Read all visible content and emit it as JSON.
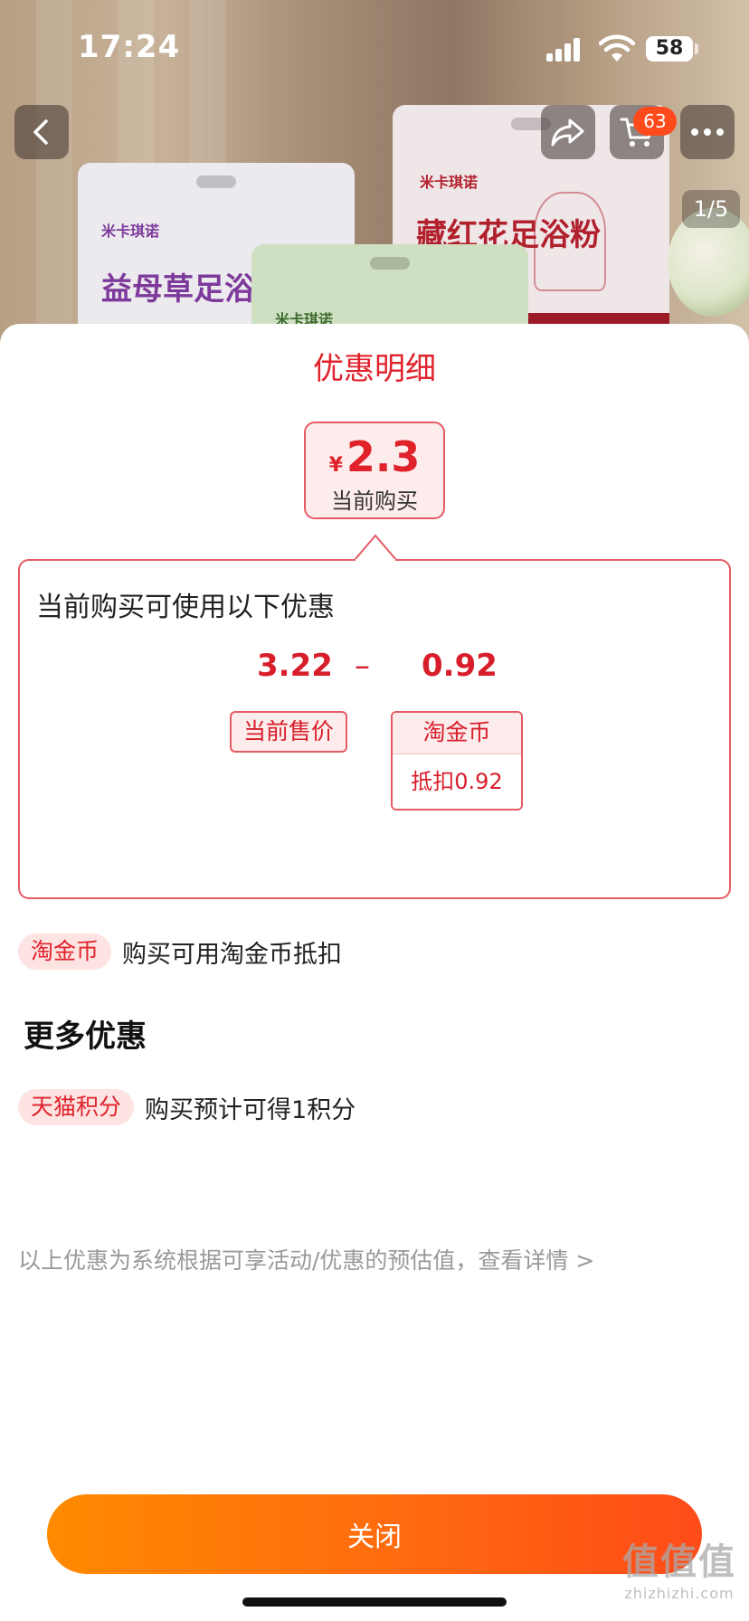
{
  "status_bar": {
    "time": "17:24",
    "battery": "58"
  },
  "product_nav": {
    "cart_count": "63",
    "image_pager": "1/5"
  },
  "product_images": {
    "left_brand": "米卡琪诺",
    "left_name": "益母草足浴粉",
    "mid_brand": "米卡琪诺",
    "right_brand": "米卡琪诺",
    "right_name": "藏红花足浴粉"
  },
  "sheet": {
    "title": "优惠明细",
    "price_card": {
      "currency": "¥",
      "amount": "2.3",
      "label": "当前购买"
    },
    "detail": {
      "title": "当前购买可使用以下优惠",
      "current_price_value": "3.22",
      "minus": "–",
      "coin_value": "0.92",
      "current_price_label": "当前售价",
      "coin_label": "淘金币",
      "coin_deduct": "抵扣0.92"
    },
    "coin_row": {
      "tag": "淘金币",
      "text": "购买可用淘金币抵扣"
    },
    "more_title": "更多优惠",
    "points_row": {
      "tag": "天猫积分",
      "text": "购买预计可得1积分"
    },
    "disclaimer": "以上优惠为系统根据可享活动/优惠的预估值，查看详情 >",
    "close_label": "关闭"
  },
  "watermark": {
    "main": "值值值",
    "sub": "zhizhizhi.com"
  },
  "colors": {
    "accent_red": "#e0222b",
    "tag_bg": "#fdecec",
    "button_gradient_start": "#ff8a00",
    "button_gradient_end": "#ff4b18"
  },
  "icons": [
    "back-icon",
    "share-icon",
    "cart-icon",
    "more-icon",
    "signal-icon",
    "wifi-icon",
    "battery-icon"
  ]
}
